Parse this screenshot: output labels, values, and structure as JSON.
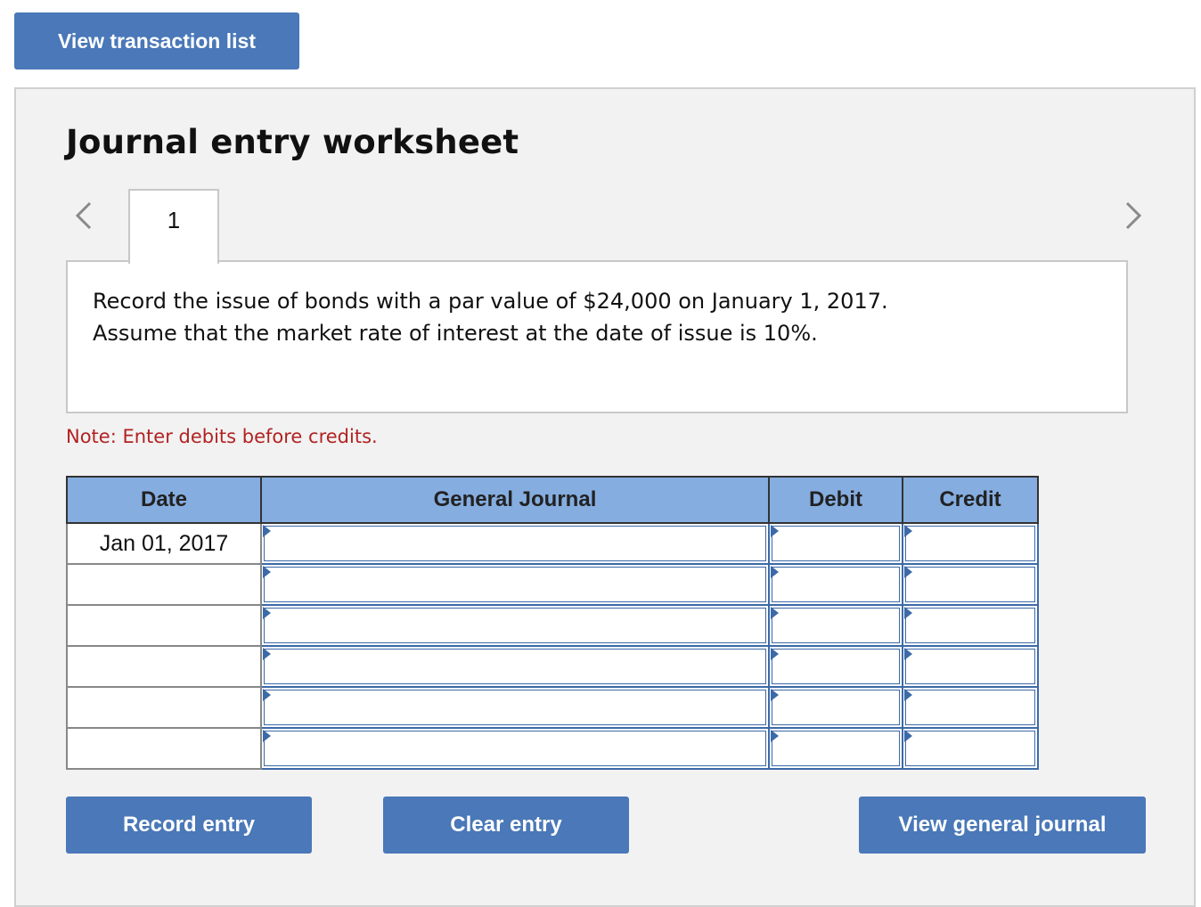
{
  "toolbar": {
    "view_transaction_list": "View transaction list"
  },
  "worksheet": {
    "title": "Journal entry worksheet",
    "tab_label": "1",
    "description_line1": "Record the issue of bonds with a par value of $24,000 on January 1, 2017.",
    "description_line2": "Assume that the market rate of interest at the date of issue is 10%.",
    "note": "Note: Enter debits before credits."
  },
  "table": {
    "headers": [
      "Date",
      "General Journal",
      "Debit",
      "Credit"
    ],
    "rows": [
      {
        "date": "Jan 01, 2017",
        "account": "",
        "debit": "",
        "credit": ""
      },
      {
        "date": "",
        "account": "",
        "debit": "",
        "credit": ""
      },
      {
        "date": "",
        "account": "",
        "debit": "",
        "credit": ""
      },
      {
        "date": "",
        "account": "",
        "debit": "",
        "credit": ""
      },
      {
        "date": "",
        "account": "",
        "debit": "",
        "credit": ""
      },
      {
        "date": "",
        "account": "",
        "debit": "",
        "credit": ""
      }
    ]
  },
  "actions": {
    "record_entry": "Record entry",
    "clear_entry": "Clear entry",
    "view_general_journal": "View general journal"
  },
  "colors": {
    "button_bg": "#4a78b8",
    "header_bg": "#85ade0",
    "note_color": "#b22222",
    "panel_bg": "#f2f2f2",
    "input_border": "#3c6aa8"
  },
  "icons": {
    "prev": "chevron-left-icon",
    "next": "chevron-right-icon",
    "field_marker": "triangle-marker-icon"
  }
}
